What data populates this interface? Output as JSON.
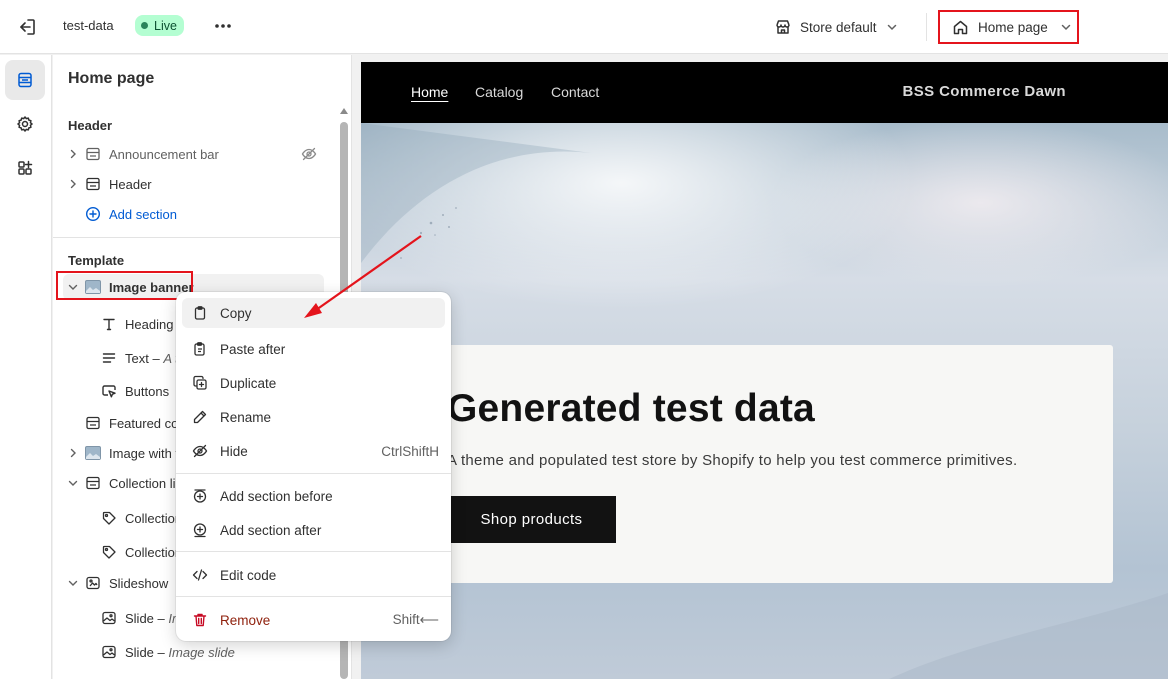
{
  "topbar": {
    "store_name": "test-data",
    "status_badge": "Live",
    "theme_selector": "Store default",
    "page_selector": "Home page"
  },
  "rail": {
    "items": [
      "sections",
      "theme-settings",
      "apps"
    ]
  },
  "sidebar": {
    "title": "Home page",
    "header_group": {
      "heading": "Header",
      "items": [
        {
          "label": "Announcement bar",
          "icon": "section-icon",
          "hidden": true
        },
        {
          "label": "Header",
          "icon": "section-icon"
        }
      ],
      "add_section": "Add section"
    },
    "template_group": {
      "heading": "Template",
      "image_banner": "Image banner",
      "heading_block": "Heading",
      "text_block": "Text",
      "text_block_suffix": "A t",
      "buttons_block": "Buttons",
      "featured": "Featured co",
      "image_with_text": "Image with t",
      "collection_list": "Collection li",
      "collection_1": "Collection",
      "collection_2": "Collection",
      "slideshow": "Slideshow",
      "slide_1": "Slide",
      "slide_1_suffix": "Ima",
      "slide_2": "Slide",
      "slide_2_suffix": "Image slide",
      "dash": "–"
    }
  },
  "context_menu": {
    "copy": "Copy",
    "paste_after": "Paste after",
    "duplicate": "Duplicate",
    "rename": "Rename",
    "hide": "Hide",
    "hide_shortcut": "CtrlShiftH",
    "add_before": "Add section before",
    "add_after": "Add section after",
    "edit_code": "Edit code",
    "remove": "Remove",
    "remove_shortcut": "Shift⟵"
  },
  "preview": {
    "nav": [
      "Home",
      "Catalog",
      "Contact"
    ],
    "brand": "BSS Commerce Dawn",
    "banner_heading": "Generated test data",
    "banner_text": "A theme and populated test store by Shopify to help you test commerce primitives.",
    "banner_button": "Shop products"
  },
  "colors": {
    "annotation_red": "#e4141c",
    "live_badge_bg": "#b4fed2",
    "link_blue": "#005bd3",
    "remove_red": "#8e1f0b"
  }
}
